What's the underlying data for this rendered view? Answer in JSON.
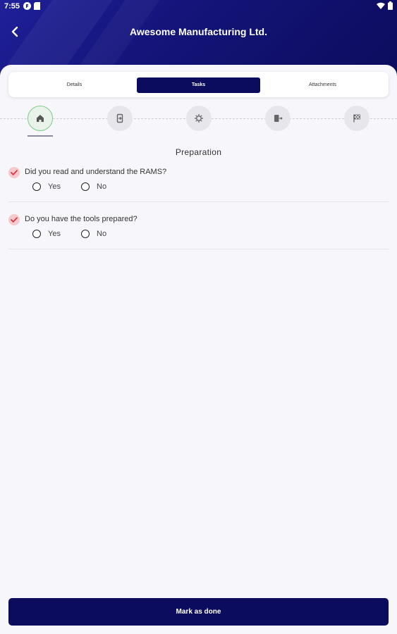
{
  "status_bar": {
    "time": "7:55"
  },
  "header": {
    "title": "Awesome Manufacturing Ltd."
  },
  "tabs": [
    {
      "label": "Details"
    },
    {
      "label": "Tasks",
      "active": true
    },
    {
      "label": "Attachments"
    }
  ],
  "steps": [
    {
      "icon": "home-icon",
      "active": true
    },
    {
      "icon": "checkin-icon",
      "active": false
    },
    {
      "icon": "gear-icon",
      "active": false
    },
    {
      "icon": "logout-icon",
      "active": false
    },
    {
      "icon": "finish-flag-icon",
      "active": false
    }
  ],
  "section": {
    "title": "Preparation"
  },
  "questions": [
    {
      "text": "Did you read and understand the RAMS?",
      "options": [
        "Yes",
        "No"
      ]
    },
    {
      "text": "Do you have the tools prepared?",
      "options": [
        "Yes",
        "No"
      ]
    }
  ],
  "footer": {
    "button_label": "Mark as done"
  },
  "colors": {
    "primary": "#0c0c5e",
    "step_active_border": "#7ecb86",
    "check_badge": "#f7c9cc",
    "check_mark": "#d9323f"
  }
}
